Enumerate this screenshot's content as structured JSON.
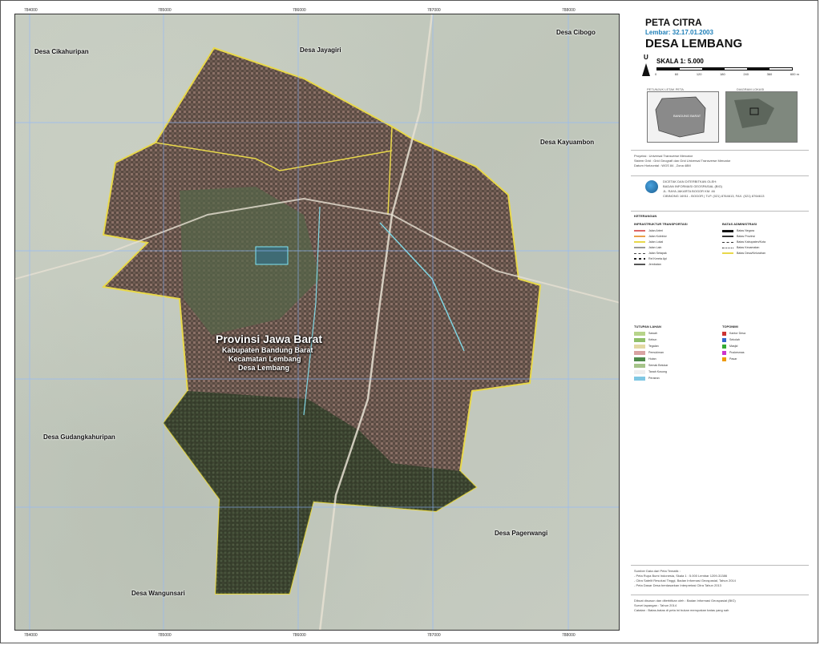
{
  "header": {
    "title_small": "PETA CITRA",
    "sheet": "Lembar: 32.17.01.2003",
    "title_main": "DESA LEMBANG",
    "north_letter": "U",
    "scale": "SKALA 1: 5.000",
    "scale_ticks": [
      "0",
      "60",
      "120",
      "180",
      "240",
      "360",
      "600 m"
    ]
  },
  "map": {
    "admin_labels": {
      "province": "Provinsi Jawa Barat",
      "regency": "Kabupaten Bandung Barat",
      "district": "Kecamatan Lembang",
      "village": "Desa Lembang"
    },
    "neighbor_villages": [
      "Desa Cikahuripan",
      "Desa Jayagiri",
      "Desa Cibogo",
      "Desa Kayuambon",
      "Desa Gudangkahuripan",
      "Desa Pagerwangi",
      "Desa Wangunsari"
    ],
    "top_coords": [
      "784000",
      "785000",
      "786000",
      "787000",
      "788000"
    ],
    "bottom_coords": [
      "784000",
      "785000",
      "786000",
      "787000",
      "788000"
    ],
    "colors": {
      "boundary": "#e8d84a",
      "grid": "#8fb8ff",
      "admin_text": "#ffffff"
    }
  },
  "panel": {
    "inset_labels": [
      "PETUNJUK LETAK PETA",
      "DIAGRAM LOKASI"
    ],
    "inset_text": "BANDUNG BARAT",
    "projection_lines": [
      "Proyeksi : Universal Transverse Mercator",
      "Sistem Grid : Grid Geografi dan Grid Universal Transverse Mercator",
      "Datum Horizontal : WGS 84 , Zona 48M"
    ],
    "agency_lines": [
      "DICETAK DAN DITERBITKAN OLEH:",
      "BADAN INFORMASI GEOSPASIAL (BIG)",
      "JL. RAYA JAKARTA BOGOR KM. 46",
      "CIBINONG 16911 - BOGOR | TLP. (021) 8764613, FAX. (021) 8764613"
    ],
    "legend_title": "KETERANGAN",
    "legend_sections": [
      {
        "heading": "INFRASTRUKTUR TRANSPORTASI",
        "items": [
          "Jalan Arteri",
          "Jalan Kolektor",
          "Jalan Lokal",
          "Jalan Lain",
          "Jalan Setapak",
          "Rel Kereta Api",
          "Jembatan"
        ]
      },
      {
        "heading": "BATAS ADMINISTRASI",
        "items": [
          "Batas Negara",
          "Batas Provinsi",
          "Batas Kabupaten/Kota",
          "Batas Kecamatan",
          "Batas Desa/Kelurahan"
        ]
      },
      {
        "heading": "TUTUPAN LAHAN",
        "items": [
          "Sawah",
          "Kebun",
          "Tegalan",
          "Pemukiman",
          "Hutan",
          "Semak Belukar",
          "Tanah Kosong",
          "Perairan"
        ]
      },
      {
        "heading": "TOPONIMI",
        "items": [
          "Kantor Desa",
          "Sekolah",
          "Masjid",
          "Puskesmas",
          "Pasar"
        ]
      }
    ],
    "source_lines": [
      "Sumber Data dari Peta Tematik :",
      "- Peta Rupa Bumi Indonesia, Skala 1 : 5.000 Lembar 1209-31386",
      "- Citra Satelit Resolusi Tinggi, Badan Informasi Geospasial, Tahun 2014",
      "- Peta Dasar Desa berdasarkan Interpretasi Citra Tahun 2013"
    ],
    "credit_lines": [
      "Dibuat disusun dan diterbitkan oleh : Badan Informasi Geospasial (BIG)",
      "Survei lapangan : Tahun 2014",
      "Catatan : Batas-batas di peta ini bukan merupakan batas yang sah"
    ]
  }
}
